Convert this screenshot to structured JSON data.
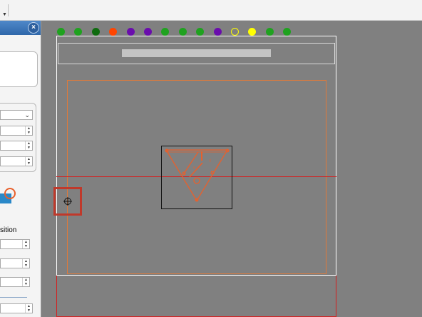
{
  "panel": {
    "close_icon": "×",
    "label_position": "sition"
  },
  "indicator_dots": [
    {
      "color": "#1fa21f"
    },
    {
      "color": "#1fa21f"
    },
    {
      "color": "#0f6b0f"
    },
    {
      "color": "#ff4500"
    },
    {
      "color": "#6a0dad"
    },
    {
      "color": "#6a0dad"
    },
    {
      "color": "#1fa21f"
    },
    {
      "color": "#1fa21f"
    },
    {
      "color": "#1fa21f"
    },
    {
      "color": "#6a0dad"
    },
    {
      "color": "outline-yellow"
    },
    {
      "color": "#ffff00"
    },
    {
      "color": "#1fa21f"
    },
    {
      "color": "#1fa21f"
    }
  ],
  "colors": {
    "canvas_bg": "#808080",
    "red_guide": "#d42020",
    "orange_guide": "#e07a3a",
    "white_guide": "#ffffff",
    "shape_orange": "#e8602c",
    "selected_box": "#c0392b"
  },
  "icons": {
    "crosshair": "crosshair-icon",
    "shape_thumb": "shape-thumbnail-icon"
  }
}
